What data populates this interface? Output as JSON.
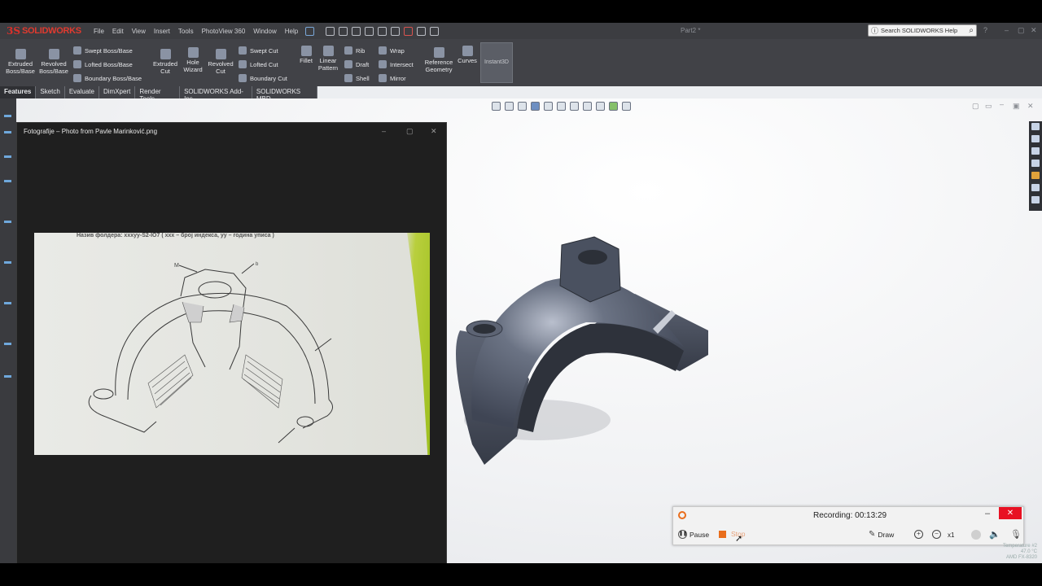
{
  "app": {
    "logo_prefix": "3S",
    "logo_name": "SOLIDWORKS",
    "doc_title": "Part2 *",
    "search_placeholder": "Search SOLIDWORKS Help"
  },
  "menu": [
    "File",
    "Edit",
    "View",
    "Insert",
    "Tools",
    "PhotoView 360",
    "Window",
    "Help"
  ],
  "ribbon": {
    "extruded_boss": "Extruded\nBoss/Base",
    "revolved_boss": "Revolved\nBoss/Base",
    "swept_boss": "Swept Boss/Base",
    "lofted_boss": "Lofted Boss/Base",
    "boundary_boss": "Boundary Boss/Base",
    "extruded_cut": "Extruded\nCut",
    "hole_wizard": "Hole\nWizard",
    "revolved_cut": "Revolved\nCut",
    "swept_cut": "Swept Cut",
    "lofted_cut": "Lofted Cut",
    "boundary_cut": "Boundary Cut",
    "fillet": "Fillet",
    "linear_pattern": "Linear\nPattern",
    "rib": "Rib",
    "draft": "Draft",
    "shell": "Shell",
    "wrap": "Wrap",
    "intersect": "Intersect",
    "mirror": "Mirror",
    "reference_geometry": "Reference\nGeometry",
    "curves": "Curves",
    "instant3d": "Instant3D"
  },
  "tabs": [
    "Features",
    "Sketch",
    "Evaluate",
    "DimXpert",
    "Render Tools",
    "SOLIDWORKS Add-Ins",
    "SOLIDWORKS MBD"
  ],
  "viewer": {
    "title": "Fotografije – Photo from Pavle Marinković.png",
    "photo_header": "Назив фолдера: xxxyy-S2-IO7 ( xxx – број индекса, yy – година уписа )"
  },
  "recorder": {
    "status": "Recording:  00:13:29",
    "pause": "Pause",
    "stop": "Stop",
    "draw": "Draw",
    "zoom_level": "x1"
  },
  "sysinfo": {
    "line1": "Temperature #2",
    "line2": "AMD FX-8320",
    "line3": "47.0 °C"
  },
  "colors": {
    "accent_red": "#e03a2f",
    "record_orange": "#e96d1b",
    "close_red": "#e81123",
    "model_grey": "#4a5160"
  }
}
